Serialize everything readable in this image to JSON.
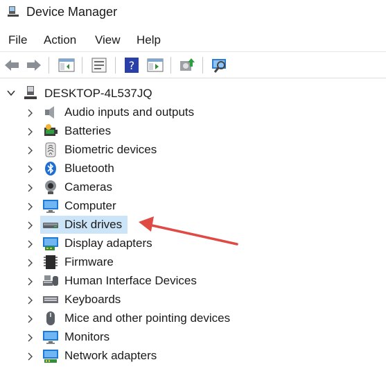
{
  "window": {
    "title": "Device Manager",
    "app_icon": "device-manager-icon"
  },
  "menubar": {
    "items": [
      "File",
      "Action",
      "View",
      "Help"
    ]
  },
  "toolbar": {
    "buttons": [
      "back-icon",
      "forward-icon",
      "show-hide-console-tree-icon",
      "properties-icon",
      "help-icon",
      "run-icon",
      "update-driver-icon",
      "scan-hardware-icon"
    ]
  },
  "tree": {
    "root": {
      "label": "DESKTOP-4L537JQ",
      "icon": "computer-icon",
      "expanded": true
    },
    "nodes": [
      {
        "label": "Audio inputs and outputs",
        "icon": "speaker-icon"
      },
      {
        "label": "Batteries",
        "icon": "battery-icon"
      },
      {
        "label": "Biometric devices",
        "icon": "fingerprint-icon"
      },
      {
        "label": "Bluetooth",
        "icon": "bluetooth-icon"
      },
      {
        "label": "Cameras",
        "icon": "camera-icon"
      },
      {
        "label": "Computer",
        "icon": "monitor-icon"
      },
      {
        "label": "Disk drives",
        "icon": "disk-drive-icon",
        "selected": true
      },
      {
        "label": "Display adapters",
        "icon": "display-adapter-icon"
      },
      {
        "label": "Firmware",
        "icon": "chip-icon"
      },
      {
        "label": "Human Interface Devices",
        "icon": "hid-icon"
      },
      {
        "label": "Keyboards",
        "icon": "keyboard-icon"
      },
      {
        "label": "Mice and other pointing devices",
        "icon": "mouse-icon"
      },
      {
        "label": "Monitors",
        "icon": "monitor-icon"
      },
      {
        "label": "Network adapters",
        "icon": "network-adapter-icon"
      }
    ]
  },
  "annotation": {
    "color": "#e04a44"
  },
  "colors": {
    "selection": "#cce4f7",
    "accent": "#0078d4"
  }
}
